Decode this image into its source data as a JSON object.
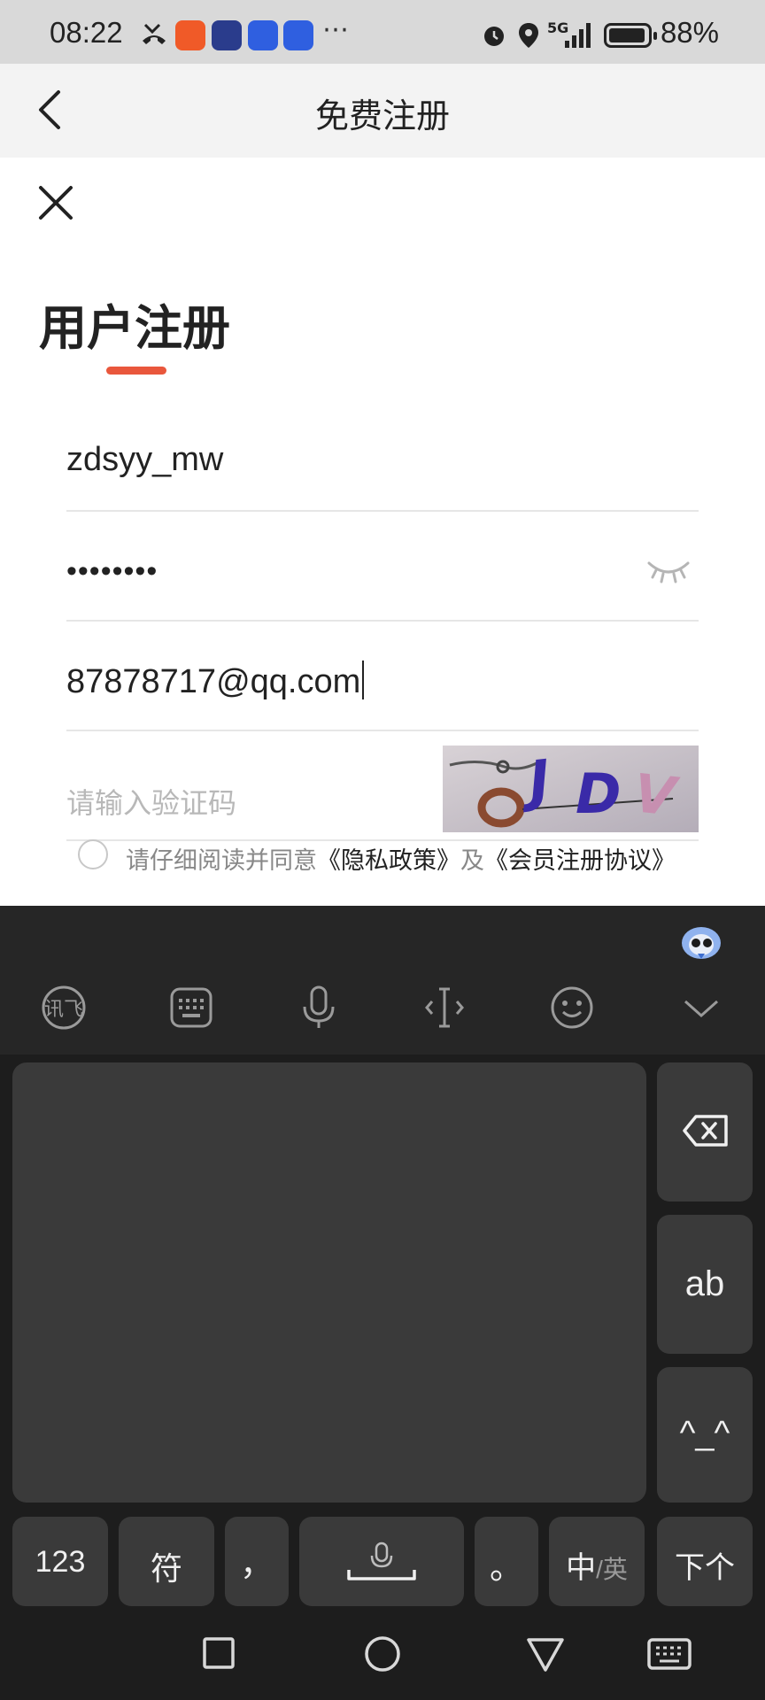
{
  "status_bar": {
    "time": "08:22",
    "network": "5G",
    "battery": "88%"
  },
  "header": {
    "title": "免费注册"
  },
  "form": {
    "title": "用户注册",
    "username": "zdsyy_mw",
    "password_masked": "••••••••",
    "email": "87878717@qq.com",
    "captcha_placeholder": "请输入验证码",
    "captcha_text": "JDV",
    "agreement_prefix": "请仔细阅读并同意",
    "privacy_link": "《隐私政策》",
    "agreement_and": "及",
    "member_link": "《会员注册协议》"
  },
  "keyboard": {
    "toolbar_icons": [
      "ifly-logo-icon",
      "keyboard-layout-icon",
      "microphone-icon",
      "cursor-move-icon",
      "emoji-icon",
      "collapse-keyboard-icon"
    ],
    "key_ab": "ab",
    "key_kaomoji": "^_^",
    "key_123": "123",
    "key_symbol": "符",
    "key_comma": "，",
    "key_period": "。",
    "key_lang_main": "中",
    "key_lang_alt": "/英",
    "key_next": "下个"
  },
  "colors": {
    "accent": "#e9573c",
    "keyboard_bg": "#1d1d1d",
    "key_bg": "#3a3a3a"
  }
}
